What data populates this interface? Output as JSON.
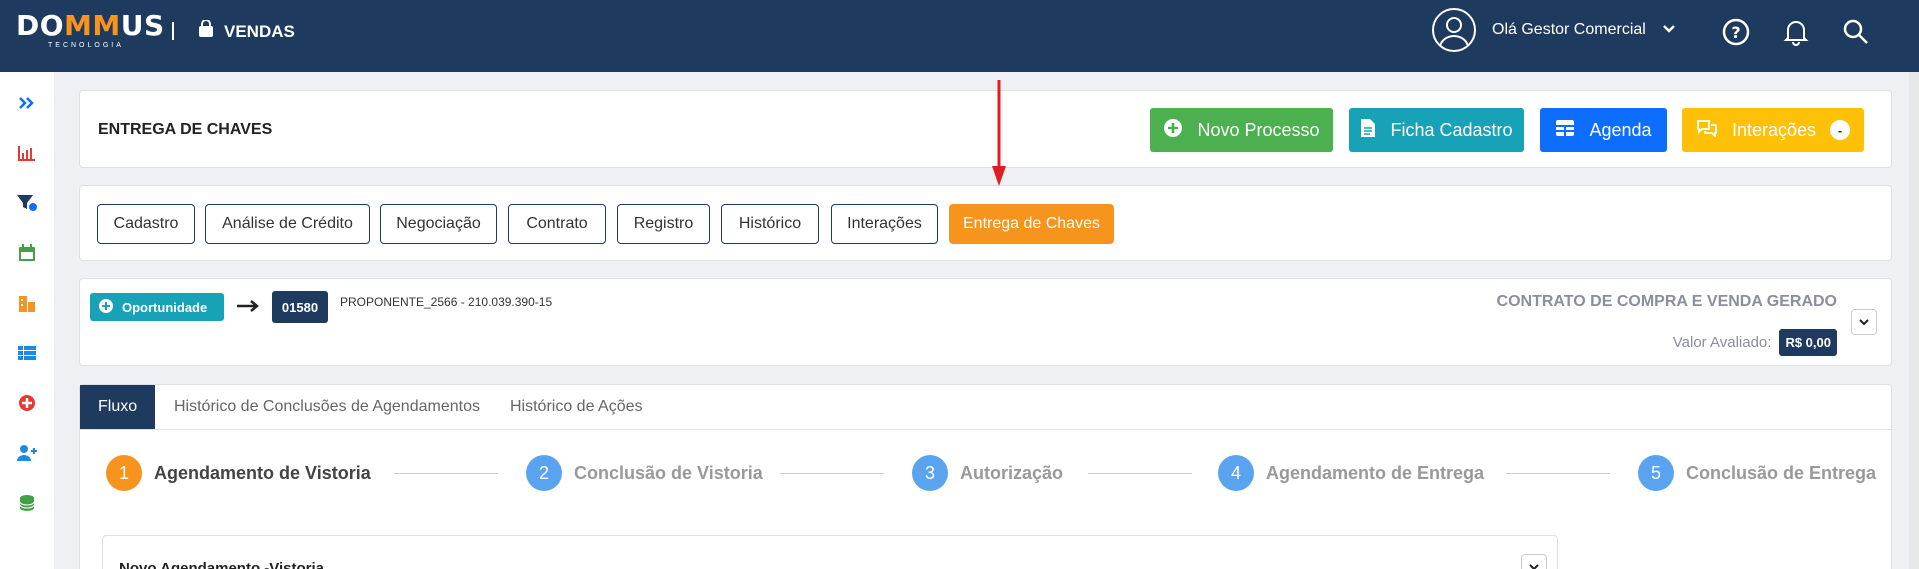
{
  "header": {
    "logo_text": "DOMMUS",
    "logo_sub": "TECNOLOGIA",
    "module_label": "VENDAS",
    "greeting": "Olá Gestor Comercial",
    "icons": [
      "help-icon",
      "bell-icon",
      "search-icon"
    ]
  },
  "sidebar": {
    "items": [
      "expand-icon",
      "chart-icon",
      "filter-icon",
      "calendar-icon",
      "building-icon",
      "list-icon",
      "plus-circle-icon",
      "add-user-icon",
      "coins-icon"
    ]
  },
  "page": {
    "title": "ENTREGA DE CHAVES",
    "actions": [
      {
        "label": "Novo Processo",
        "color": "#4caf50",
        "icon": "plus-circle-icon"
      },
      {
        "label": "Ficha Cadastro",
        "color": "#17a2b8",
        "icon": "document-icon"
      },
      {
        "label": "Agenda",
        "color": "#0d6efd",
        "icon": "table-icon"
      },
      {
        "label": "Interações",
        "color": "#ffc107",
        "icon": "chat-icon",
        "badge": "-"
      }
    ]
  },
  "process_tabs": [
    {
      "label": "Cadastro"
    },
    {
      "label": "Análise de Crédito"
    },
    {
      "label": "Negociação"
    },
    {
      "label": "Contrato"
    },
    {
      "label": "Registro"
    },
    {
      "label": "Histórico"
    },
    {
      "label": "Interações"
    },
    {
      "label": "Entrega de Chaves",
      "active": true
    }
  ],
  "opportunity": {
    "badge_label": "Oportunidade",
    "id": "01580",
    "proponent": "PROPONENTE_2566 - 210.039.390-15",
    "contract_status": "CONTRATO DE COMPRA E VENDA GERADO",
    "valor_label": "Valor Avaliado:",
    "valor_value": "R$ 0,00"
  },
  "panel_tabs": [
    {
      "label": "Fluxo",
      "active": true
    },
    {
      "label": "Histórico de Conclusões de Agendamentos"
    },
    {
      "label": "Histórico de Ações"
    }
  ],
  "steps": [
    {
      "num": "1",
      "label": "Agendamento de Vistoria",
      "current": true
    },
    {
      "num": "2",
      "label": "Conclusão de Vistoria"
    },
    {
      "num": "3",
      "label": "Autorização"
    },
    {
      "num": "4",
      "label": "Agendamento de Entrega"
    },
    {
      "num": "5",
      "label": "Conclusão de Entrega"
    }
  ],
  "sub_card": {
    "title": "Novo Agendamento -Vistoria"
  },
  "colors": {
    "navy": "#1f3a5f",
    "orange": "#f7941d",
    "step_blue": "#5aa3ee",
    "arrow_red": "#e31b23"
  }
}
